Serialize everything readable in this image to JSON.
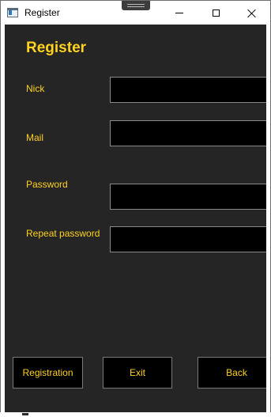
{
  "window": {
    "title": "Register",
    "icon": "app-window-icon",
    "controls": {
      "minimize_icon": "minimize-icon",
      "maximize_icon": "maximize-icon",
      "close_icon": "close-icon"
    }
  },
  "form": {
    "heading": "Register",
    "fields": {
      "nick": {
        "label": "Nick",
        "value": ""
      },
      "mail": {
        "label": "Mail",
        "value": ""
      },
      "password": {
        "label": "Password",
        "value": ""
      },
      "repeat_password": {
        "label": "Repeat password",
        "value": ""
      }
    }
  },
  "buttons": {
    "registration": "Registration",
    "exit": "Exit",
    "back": "Back"
  },
  "colors": {
    "accent": "#ffd21f",
    "background": "#252525",
    "field_background": "#000000",
    "field_border": "#8a8a8a"
  }
}
